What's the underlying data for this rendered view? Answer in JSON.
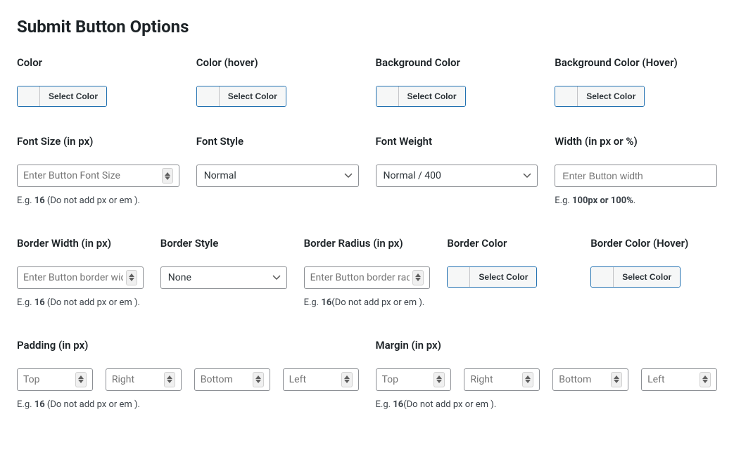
{
  "title": "Submit Button Options",
  "btn_select_color": "Select Color",
  "row1": {
    "color": {
      "label": "Color"
    },
    "color_hover": {
      "label": "Color (hover)"
    },
    "bg": {
      "label": "Background Color"
    },
    "bg_hover": {
      "label": "Background Color (Hover)"
    }
  },
  "row2": {
    "font_size": {
      "label": "Font Size (in px)",
      "placeholder": "Enter Button Font Size",
      "hint_pre": "E.g. ",
      "hint_bold": "16",
      "hint_post": " (Do not add px or em )."
    },
    "font_style": {
      "label": "Font Style",
      "value": "Normal"
    },
    "font_weight": {
      "label": "Font Weight",
      "value": "Normal / 400"
    },
    "width": {
      "label": "Width (in px or %)",
      "placeholder": "Enter Button width",
      "hint_pre": "E.g. ",
      "hint_bold": "100px or 100%",
      "hint_post": "."
    }
  },
  "row3": {
    "border_width": {
      "label": "Border Width (in px)",
      "placeholder": "Enter Button border wid",
      "hint_pre": "E.g. ",
      "hint_bold": "16",
      "hint_post": " (Do not add px or em )."
    },
    "border_style": {
      "label": "Border Style",
      "value": "None"
    },
    "border_radius": {
      "label": "Border Radius (in px)",
      "placeholder": "Enter Button border rad",
      "hint_pre": "E.g. ",
      "hint_bold": "16",
      "hint_post": "(Do not add px or em )."
    },
    "border_color": {
      "label": "Border Color"
    },
    "border_color_hover": {
      "label": "Border Color (Hover)"
    }
  },
  "row4": {
    "padding": {
      "label": "Padding (in px)",
      "top": "Top",
      "right": "Right",
      "bottom": "Bottom",
      "left": "Left",
      "hint_pre": "E.g. ",
      "hint_bold": "16",
      "hint_post": " (Do not add px or em )."
    },
    "margin": {
      "label": "Margin (in px)",
      "top": "Top",
      "right": "Right",
      "bottom": "Bottom",
      "left": "Left",
      "hint_pre": "E.g. ",
      "hint_bold": "16",
      "hint_post": "(Do not add px or em )."
    }
  }
}
